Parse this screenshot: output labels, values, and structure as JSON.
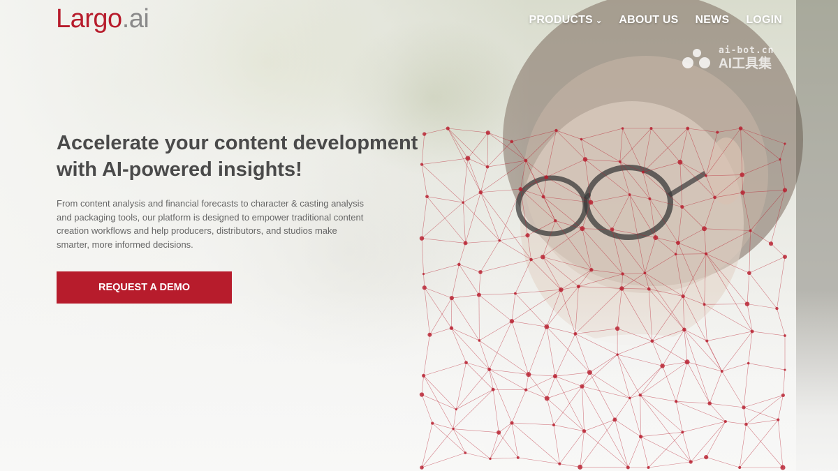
{
  "brand": {
    "logo_main": "Largo",
    "logo_sub": ".ai",
    "accent_color": "#b71c2c"
  },
  "nav": {
    "items": [
      {
        "label": "PRODUCTS",
        "has_dropdown": true
      },
      {
        "label": "ABOUT US"
      },
      {
        "label": "NEWS"
      },
      {
        "label": "LOGIN"
      }
    ]
  },
  "watermark": {
    "top": "ai-bot.cn",
    "bottom": "AI工具集"
  },
  "hero": {
    "headline_line1": "Accelerate your content development",
    "headline_line2": "with AI-powered insights!",
    "description": "From content analysis and financial forecasts to character & casting analysis and packaging tools, our platform is designed to empower traditional content creation workflows and help producers, distributors, and studios make smarter, more informed decisions.",
    "cta_label": "REQUEST A DEMO",
    "image_description": "boy with round glasses overlaid by face-tracking mesh"
  }
}
